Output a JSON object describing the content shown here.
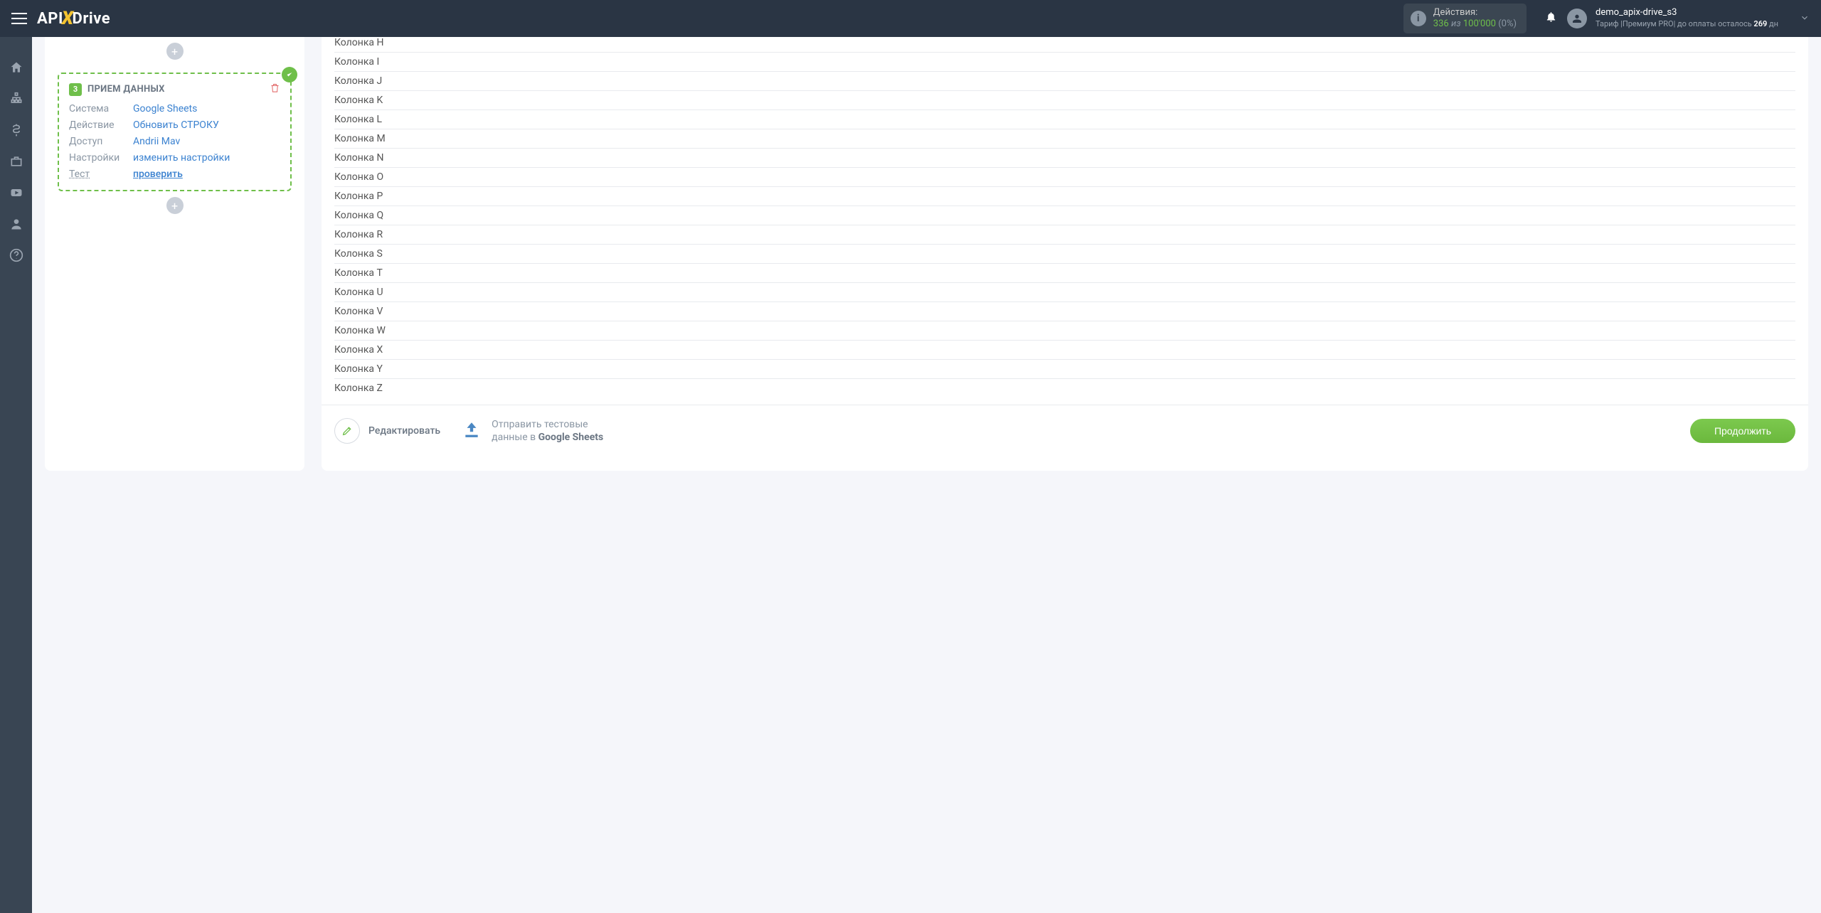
{
  "header": {
    "brand_pre": "API",
    "brand_post": "Drive",
    "actions_label": "Действия:",
    "actions_used": "336",
    "actions_of": "из",
    "actions_total": "100'000",
    "actions_pct": "(0%)",
    "username": "demo_apix-drive_s3",
    "plan_prefix": "Тариф |Премиум PRO| до оплаты осталось ",
    "plan_days": "269",
    "plan_suffix": " дн"
  },
  "step": {
    "num": "3",
    "title": "ПРИЕМ ДАННЫХ",
    "rows": {
      "system_k": "Система",
      "system_v": "Google Sheets",
      "action_k": "Действие",
      "action_v": "Обновить СТРОКУ",
      "access_k": "Доступ",
      "access_v": "Andrii Mav",
      "settings_k": "Настройки",
      "settings_v": "изменить настройки",
      "test_k": "Тест",
      "test_v": "проверить"
    }
  },
  "columns": [
    "Колонка H",
    "Колонка I",
    "Колонка J",
    "Колонка K",
    "Колонка L",
    "Колонка M",
    "Колонка N",
    "Колонка O",
    "Колонка P",
    "Колонка Q",
    "Колонка R",
    "Колонка S",
    "Колонка T",
    "Колонка U",
    "Колонка V",
    "Колонка W",
    "Колонка X",
    "Колонка Y",
    "Колонка Z"
  ],
  "footer": {
    "edit": "Редактировать",
    "send_line1": "Отправить тестовые",
    "send_line2_pre": "данные в ",
    "send_line2_bold": "Google Sheets",
    "continue": "Продолжить"
  }
}
